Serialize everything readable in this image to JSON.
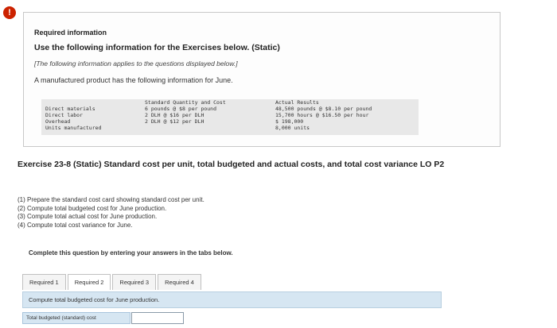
{
  "alert": {
    "symbol": "!"
  },
  "info": {
    "heading": "Required information",
    "sub": "Use the following information for the Exercises below. (Static)",
    "note": "[The following information applies to the questions displayed below.]",
    "intro": "A manufactured product has the following information for June."
  },
  "table": {
    "std_header": "Standard Quantity and Cost",
    "act_header": "Actual Results",
    "rows": [
      {
        "label": "Direct materials",
        "std": "6 pounds @ $8 per pound",
        "act": "48,500 pounds @ $8.10 per pound"
      },
      {
        "label": "Direct labor",
        "std": "2 DLH @ $16 per DLH",
        "act": "15,700 hours @ $16.50 per hour"
      },
      {
        "label": "Overhead",
        "std": "2 DLH @ $12 per DLH",
        "act": "$ 198,000"
      },
      {
        "label": "Units manufactured",
        "std": "",
        "act": "8,000 units"
      }
    ]
  },
  "exercise": {
    "title": "Exercise 23-8 (Static) Standard cost per unit, total budgeted and actual costs, and total cost variance LO P2"
  },
  "tasks": [
    "(1) Prepare the standard cost card showing standard cost per unit.",
    "(2) Compute total budgeted cost for June production.",
    "(3) Compute total actual cost for June production.",
    "(4) Compute total cost variance for June."
  ],
  "instructions": "Complete this question by entering your answers in the tabs below.",
  "tabs": [
    "Required 1",
    "Required 2",
    "Required 3",
    "Required 4"
  ],
  "active_tab": "Required 2",
  "prompt": "Compute total budgeted cost for June production.",
  "answer": {
    "label": "Total budgeted (standard) cost",
    "value": ""
  }
}
